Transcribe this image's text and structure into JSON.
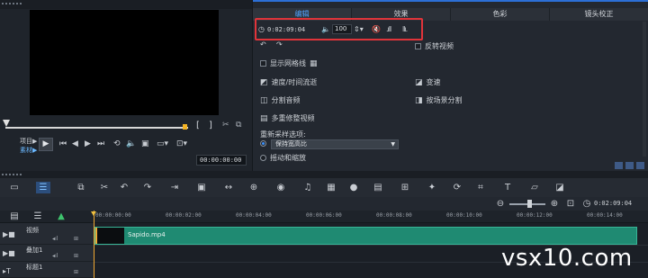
{
  "preview": {
    "bracket_in": "[",
    "bracket_out": "]",
    "project_label": "项目▶",
    "clip_label": "素材▶",
    "timecode": "00:00:00:00"
  },
  "options": {
    "tabs": [
      {
        "label": "编辑",
        "active": true
      },
      {
        "label": "效果",
        "active": false
      },
      {
        "label": "色彩",
        "active": false
      },
      {
        "label": "镜头校正",
        "active": false
      }
    ],
    "duration_timecode": "0:02:09:04",
    "volume_value": "100",
    "reverse_video": "反转视频",
    "show_grid": "显示网格线",
    "speed_time_flow": "速度/时间流逝",
    "variable_speed": "变速",
    "split_audio": "分割音频",
    "split_by_scene": "按场景分割",
    "multi_trim": "多重修整视频",
    "resample_label": "重新采样选项:",
    "resample_selected": "保持宽高比",
    "pan_zoom": "摇动和缩放"
  },
  "zoom": {
    "timecode": "0:02:09:04"
  },
  "timeline": {
    "ruler_ticks": [
      "00:00:00:00",
      "00:00:02:00",
      "00:00:04:00",
      "00:00:06:00",
      "00:00:08:00",
      "00:00:10:00",
      "00:00:12:00",
      "00:00:14:00"
    ],
    "tracks": [
      {
        "name": "视频"
      },
      {
        "name": "叠加1"
      },
      {
        "name": "标题1"
      }
    ],
    "clip_name": "Sapido.mp4"
  },
  "watermark": "vsx10.com",
  "colors": {
    "accent": "#2c6fd6",
    "highlight": "#e0343a",
    "clip": "#1f8a72",
    "playhead": "#f0a832"
  }
}
